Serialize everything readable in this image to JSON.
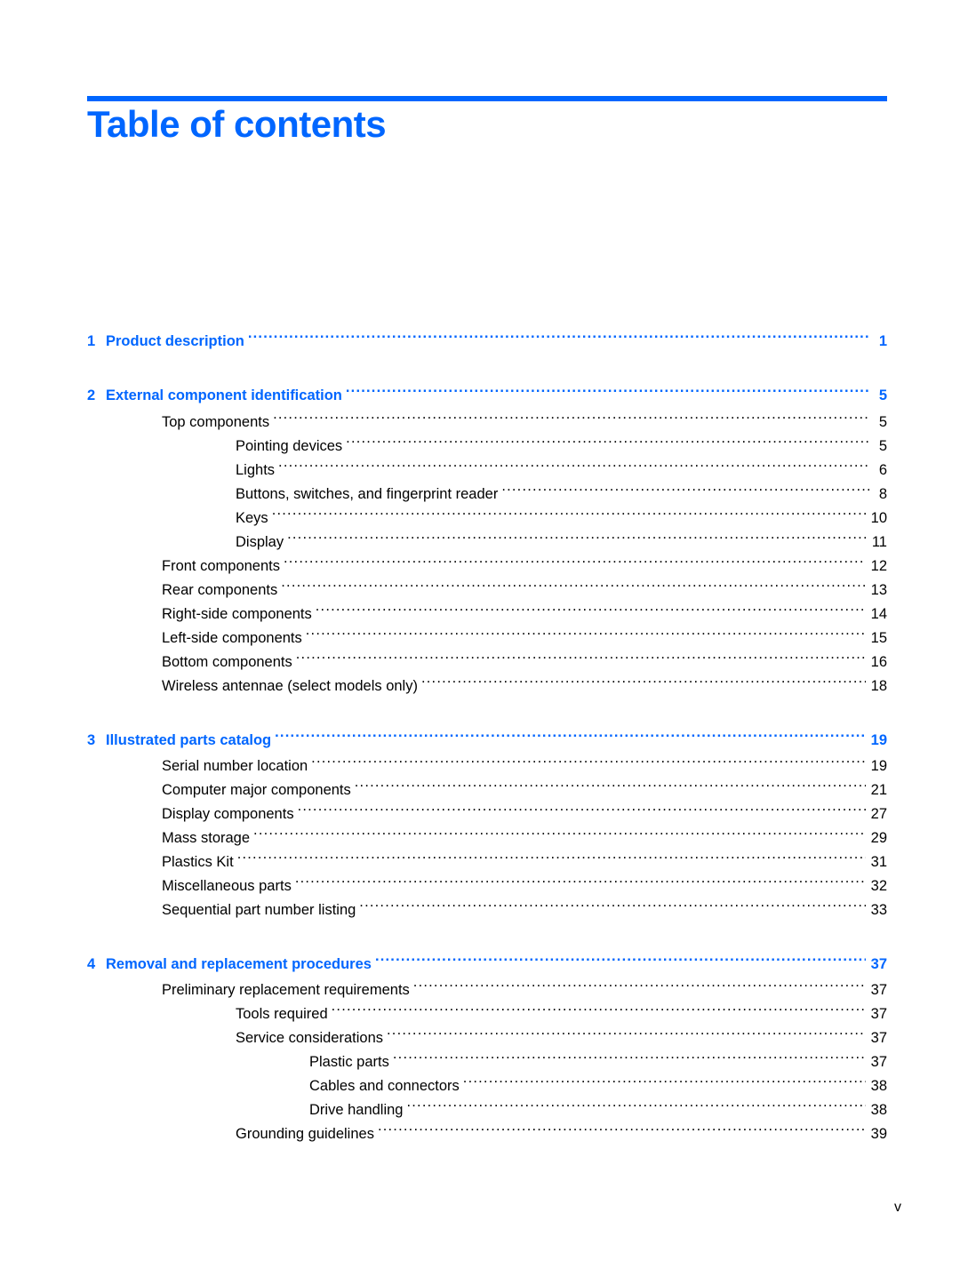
{
  "header": {
    "title": "Table of contents"
  },
  "toc": [
    {
      "level": 0,
      "number": "1",
      "label": "Product description",
      "page": "1"
    },
    {
      "level": 0,
      "number": "2",
      "label": "External component identification",
      "page": "5"
    },
    {
      "level": 1,
      "label": "Top components",
      "page": "5"
    },
    {
      "level": 2,
      "label": "Pointing devices",
      "page": "5"
    },
    {
      "level": 2,
      "label": "Lights",
      "page": "6"
    },
    {
      "level": 2,
      "label": "Buttons, switches, and fingerprint reader",
      "page": "8"
    },
    {
      "level": 2,
      "label": "Keys",
      "page": "10"
    },
    {
      "level": 2,
      "label": "Display",
      "page": "11"
    },
    {
      "level": 1,
      "label": "Front components",
      "page": "12"
    },
    {
      "level": 1,
      "label": "Rear components",
      "page": "13"
    },
    {
      "level": 1,
      "label": "Right-side components",
      "page": "14"
    },
    {
      "level": 1,
      "label": "Left-side components",
      "page": "15"
    },
    {
      "level": 1,
      "label": "Bottom components",
      "page": "16"
    },
    {
      "level": 1,
      "label": "Wireless antennae (select models only)",
      "page": "18"
    },
    {
      "level": 0,
      "number": "3",
      "label": "Illustrated parts catalog",
      "page": "19"
    },
    {
      "level": 1,
      "label": "Serial number location",
      "page": "19"
    },
    {
      "level": 1,
      "label": "Computer major components",
      "page": "21"
    },
    {
      "level": 1,
      "label": "Display components",
      "page": "27"
    },
    {
      "level": 1,
      "label": "Mass storage",
      "page": "29"
    },
    {
      "level": 1,
      "label": "Plastics Kit",
      "page": "31"
    },
    {
      "level": 1,
      "label": "Miscellaneous parts",
      "page": "32"
    },
    {
      "level": 1,
      "label": "Sequential part number listing",
      "page": "33"
    },
    {
      "level": 0,
      "number": "4",
      "label": "Removal and replacement procedures",
      "page": "37"
    },
    {
      "level": 1,
      "label": "Preliminary replacement requirements",
      "page": "37"
    },
    {
      "level": 2,
      "label": "Tools required",
      "page": "37"
    },
    {
      "level": 2,
      "label": "Service considerations",
      "page": "37"
    },
    {
      "level": 3,
      "label": "Plastic parts",
      "page": "37"
    },
    {
      "level": 3,
      "label": "Cables and connectors",
      "page": "38"
    },
    {
      "level": 3,
      "label": "Drive handling",
      "page": "38"
    },
    {
      "level": 2,
      "label": "Grounding guidelines",
      "page": "39"
    }
  ],
  "footer": {
    "page_number": "v"
  },
  "colors": {
    "accent": "#0066ff",
    "text": "#000000"
  }
}
